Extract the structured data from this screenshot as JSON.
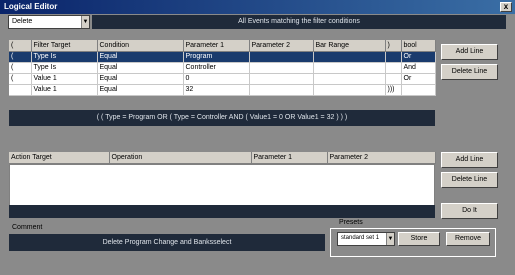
{
  "window": {
    "title": "Logical Editor",
    "close": "x"
  },
  "mode": {
    "value": "Delete",
    "caption": "All Events matching the filter conditions"
  },
  "filter": {
    "columns": [
      "(",
      "Filter Target",
      "Condition",
      "Parameter 1",
      "Parameter 2",
      "Bar Range",
      ")",
      "bool"
    ],
    "rows": [
      {
        "open": "(",
        "target": "Type Is",
        "condition": "Equal",
        "p1": "Program",
        "p2": "",
        "bar": "",
        "close": "",
        "bool": "Or",
        "selected": true
      },
      {
        "open": "(",
        "target": "Type Is",
        "condition": "Equal",
        "p1": "Controller",
        "p2": "",
        "bar": "",
        "close": "",
        "bool": "And",
        "selected": false
      },
      {
        "open": "(",
        "target": "Value 1",
        "condition": "Equal",
        "p1": "0",
        "p2": "",
        "bar": "",
        "close": "",
        "bool": "Or",
        "selected": false
      },
      {
        "open": "",
        "target": "Value 1",
        "condition": "Equal",
        "p1": "32",
        "p2": "",
        "bar": "",
        "close": ")))",
        "bool": "",
        "selected": false
      }
    ],
    "expression": "( ( Type = Program OR ( Type = Controller AND ( Value1 = 0 OR Value1 = 32 ) ) )",
    "add_line": "Add Line",
    "delete_line": "Delete Line"
  },
  "action": {
    "columns": [
      "Action Target",
      "Operation",
      "Parameter 1",
      "Parameter 2"
    ],
    "add_line": "Add Line",
    "delete_line": "Delete Line"
  },
  "do_it": "Do It",
  "comment": {
    "label": "Comment",
    "text": "Delete Program Change and Banksselect"
  },
  "presets": {
    "label": "Presets",
    "value": "standard set 1",
    "store": "Store",
    "remove": "Remove"
  }
}
